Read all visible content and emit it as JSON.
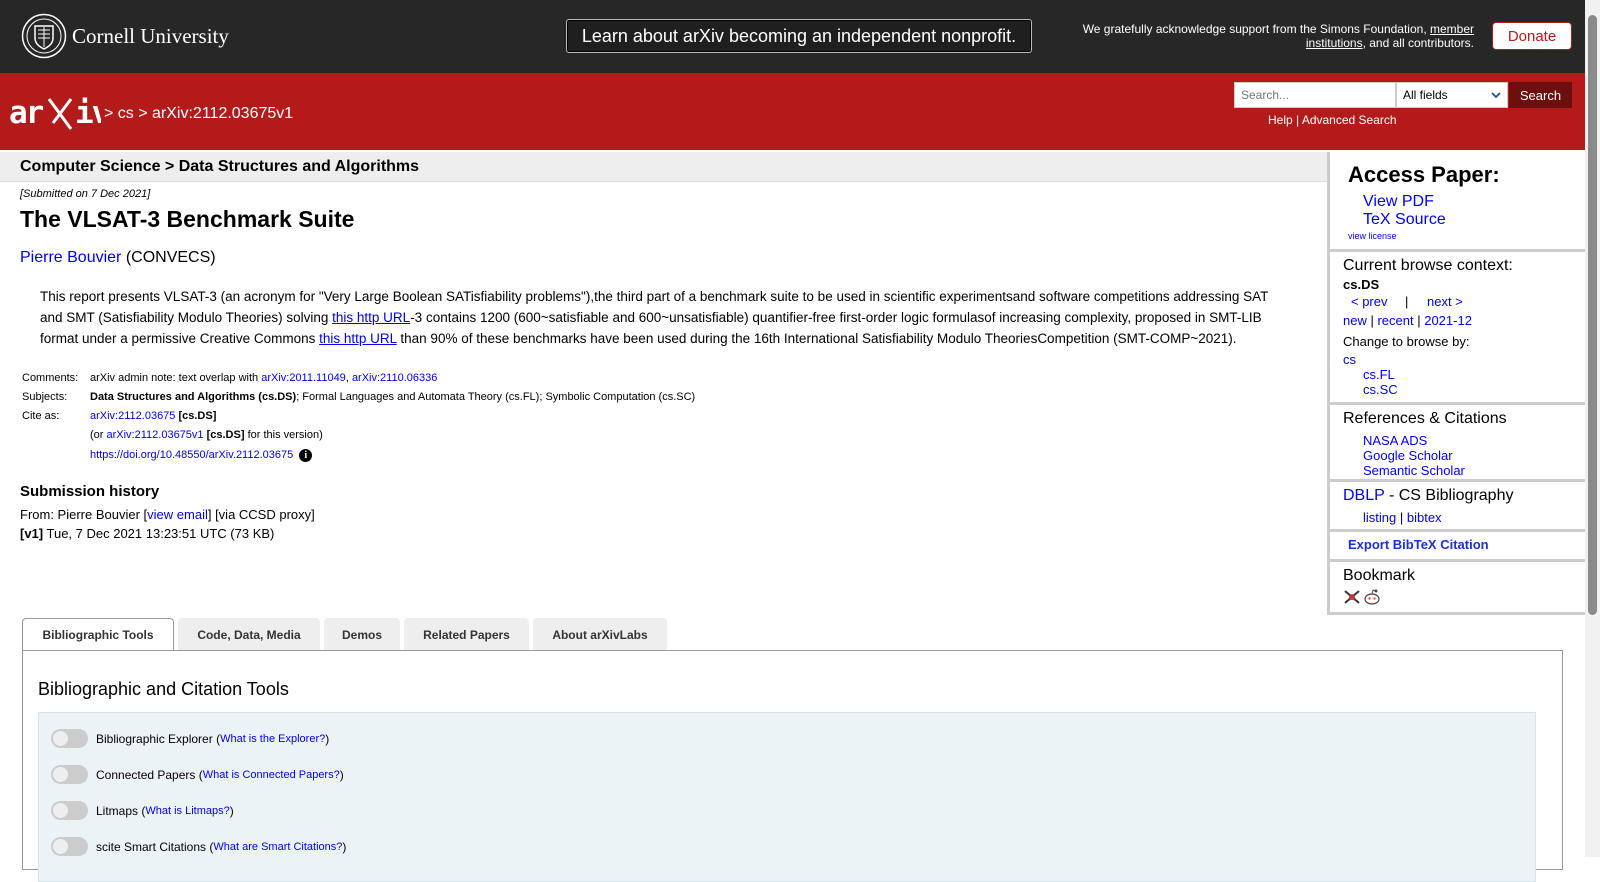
{
  "banner": {
    "cornell_name": "Cornell University",
    "nonprofit_text": "Learn about arXiv becoming an independent nonprofit.",
    "support_prefix": "We gratefully acknowledge support from the Simons Foundation, ",
    "support_link": "member institutions",
    "support_suffix": ", and all contributors.",
    "donate_label": "Donate"
  },
  "header": {
    "sep1": "> ",
    "crumb_cs": "cs",
    "sep2": " > ",
    "crumb_id": "arXiv:2112.03675v1",
    "search_placeholder": "Search...",
    "field_value": "All fields",
    "search_label": "Search",
    "help": "Help",
    "pipe": " | ",
    "advanced": "Advanced Search"
  },
  "paper": {
    "subject_header": "Computer Science > Data Structures and Algorithms",
    "submitted": "[Submitted on 7 Dec 2021]",
    "title": "The VLSAT-3 Benchmark Suite",
    "author": "Pierre Bouvier",
    "affiliation": " (CONVECS)",
    "abstract_1": "This report presents VLSAT-3 (an acronym for \"Very Large Boolean SATisfiability problems\"),the third part of a benchmark suite to be used in scientific experimentsand software competitions addressing SAT and SMT (Satisfiability Modulo Theories) solving ",
    "abstract_link_1": "this http URL",
    "abstract_2": "-3 contains 1200 (600~satisfiable and 600~unsatisfiable) quantifier-free first-order logic formulasof increasing complexity, proposed in SMT-LIB format under a permissive Creative Commons ",
    "abstract_link_2": "this http URL",
    "abstract_3": " than 90% of these benchmarks have been used during the 16th International Satisfiability Modulo TheoriesCompetition (SMT-COMP~2021)."
  },
  "meta": {
    "comments_label": "Comments:",
    "comments_text": "arXiv admin note: text overlap with ",
    "comments_link1": "arXiv:2011.11049",
    "comments_sep": ", ",
    "comments_link2": "arXiv:2110.06336",
    "subjects_label": "Subjects:",
    "subjects_primary": "Data Structures and Algorithms (cs.DS)",
    "subjects_rest": "; Formal Languages and Automata Theory (cs.FL); Symbolic Computation (cs.SC)",
    "cite_label": "Cite as:",
    "cite_link": "arXiv:2112.03675",
    "cite_tag": " [cs.DS]",
    "cite2_prefix": "(or ",
    "cite2_link": "arXiv:2112.03675v1",
    "cite2_tag": " [cs.DS]",
    "cite2_suffix": " for this version)",
    "doi": "https://doi.org/10.48550/arXiv.2112.03675",
    "info_glyph": "i"
  },
  "history": {
    "title": "Submission history",
    "from_prefix": "From: Pierre Bouvier [",
    "view_email": "view email",
    "from_suffix": "] [via CCSD proxy]",
    "v1_label": "[v1]",
    "v1_text": " Tue, 7 Dec 2021 13:23:51 UTC (73 KB)"
  },
  "sidebar": {
    "access_title": "Access Paper:",
    "view_pdf": "View PDF",
    "tex_source": "TeX Source",
    "view_license": "view license",
    "browse_title": "Current browse context:",
    "browse_ctx": "cs.DS",
    "prev": "< prev",
    "pipe": "|",
    "next": "next >",
    "new": "new",
    "recent": "recent",
    "month": "2021-12",
    "sep": " | ",
    "change_title": "Change to browse by:",
    "cs": "cs",
    "cs_fl": "cs.FL",
    "cs_sc": "cs.SC",
    "refs_title": "References & Citations",
    "nasa": "NASA ADS",
    "google": "Google Scholar",
    "semantic": "Semantic Scholar",
    "dblp": "DBLP",
    "dblp_rest": " - CS Bibliography",
    "listing": "listing",
    "bibtex": "bibtex",
    "export": "Export BibTeX Citation",
    "bookmark": "Bookmark"
  },
  "tabs": [
    {
      "label": "Bibliographic Tools"
    },
    {
      "label": "Code, Data, Media"
    },
    {
      "label": "Demos"
    },
    {
      "label": "Related Papers"
    },
    {
      "label": "About arXivLabs"
    }
  ],
  "tools": {
    "panel_title": "Bibliographic and Citation Tools",
    "items": [
      {
        "name": "Bibliographic Explorer",
        "help": "What is the Explorer?"
      },
      {
        "name": "Connected Papers",
        "help": "What is Connected Papers?"
      },
      {
        "name": "Litmaps",
        "help": "What is Litmaps?"
      },
      {
        "name": "scite Smart Citations",
        "help": "What are Smart Citations?"
      }
    ]
  },
  "colors": {
    "arxiv_red": "#b31b1b",
    "topbar": "#272727",
    "link": "#0000ee"
  }
}
